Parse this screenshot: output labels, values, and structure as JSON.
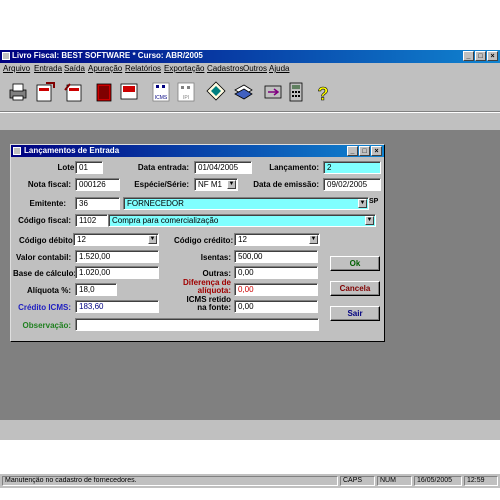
{
  "app": {
    "title": "Livro Fiscal: BEST SOFTWARE  *  Curso: ABR/2005",
    "window_buttons": {
      "minimize": "_",
      "maximize": "□",
      "close": "×"
    }
  },
  "menu": [
    "Arquivo",
    "Entrada",
    "Saída",
    "Apuração",
    "Relatórios",
    "Exportação",
    "Cadastros",
    "Outros",
    "Ajuda"
  ],
  "toolbar": {
    "icons": [
      "print-icon",
      "entry-doc-icon",
      "exit-doc-icon",
      "book-icon",
      "report-icon",
      "icms-icon",
      "ipi-icon",
      "diskette-icon",
      "books-icon",
      "transfer-icon",
      "calculator-icon",
      "help-icon"
    ],
    "icms_text": "ICMS",
    "ipi_text": "IPI",
    "help_text": "?"
  },
  "dialog": {
    "title": "Lançamentos de Entrada",
    "lote": {
      "label": "Lote:",
      "value": "01"
    },
    "data_entrada": {
      "label": "Data entrada:",
      "value": "01/04/2005"
    },
    "lancamento": {
      "label": "Lançamento:",
      "value": "2"
    },
    "nota_fiscal": {
      "label": "Nota fiscal:",
      "value": "000126"
    },
    "especie_serie": {
      "label": "Espécie/Série:",
      "value": "NF M1"
    },
    "data_emissao": {
      "label": "Data de emissão:",
      "value": "09/02/2005"
    },
    "emitente": {
      "label": "Emitente:",
      "code": "36",
      "name": "FORNECEDOR",
      "uf": "SP"
    },
    "codigo_fiscal": {
      "label": "Código fiscal:",
      "code": "1102",
      "description": "Compra para comercialização"
    },
    "codigo_debito": {
      "label": "Código débito:",
      "value": "12"
    },
    "codigo_credito": {
      "label": "Código crédito:",
      "value": "12"
    },
    "valor_contabil": {
      "label": "Valor contabil:",
      "value": "1.520,00"
    },
    "isentas": {
      "label": "Isentas:",
      "value": "500,00"
    },
    "base_calculo": {
      "label": "Base de cálculo:",
      "value": "1.020,00"
    },
    "outras": {
      "label": "Outras:",
      "value": "0,00"
    },
    "aliquota": {
      "label": "Alíquota %:",
      "value": "18,0"
    },
    "diferenca_aliquota": {
      "label_line1": "Diferença de",
      "label_line2": "alíquota:",
      "value": "0,00"
    },
    "credito_icms": {
      "label": "Crédito ICMS:",
      "value": "183,60"
    },
    "icms_retido": {
      "label_line1": "ICMS retido",
      "label_line2": "na fonte:",
      "value": "0,00"
    },
    "observacao": {
      "label": "Observação:",
      "value": ""
    },
    "buttons": {
      "ok": "Ok",
      "cancel": "Cancela",
      "exit": "Sair"
    }
  },
  "statusbar": {
    "message": "Manutenção no cadastro de fornecedores.",
    "caps": "CAPS",
    "num": "NUM",
    "date": "16/05/2005",
    "time": "12:59"
  },
  "colors": {
    "title_bar": "#000080",
    "highlight_field": "#80ffff",
    "desktop": "#808080"
  }
}
